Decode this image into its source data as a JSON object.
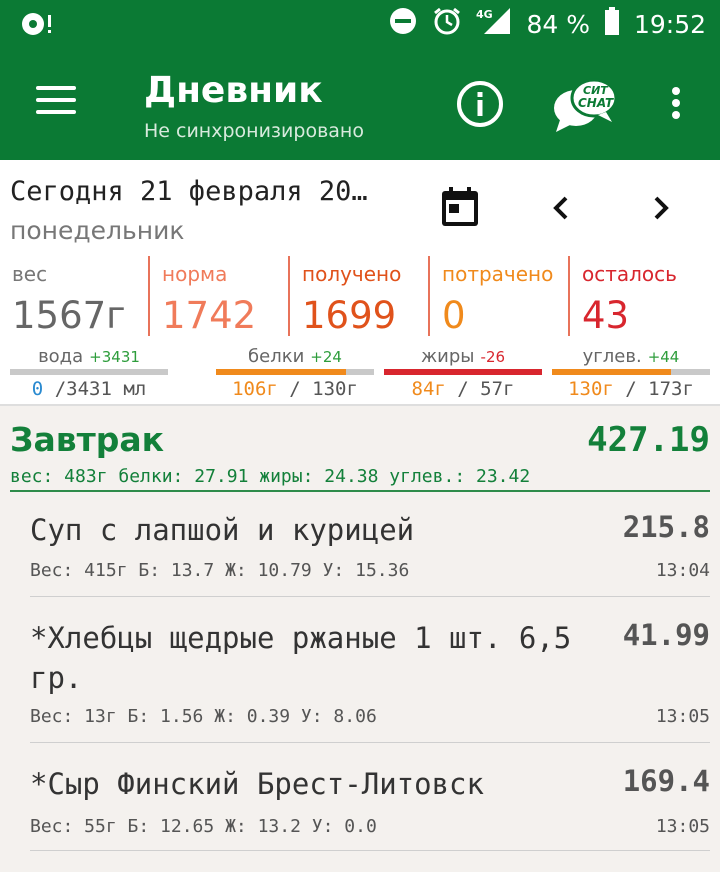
{
  "status_bar": {
    "battery": "84 %",
    "time": "19:52",
    "network": "4G"
  },
  "app_bar": {
    "title": "Дневник",
    "subtitle": "Не синхронизировано",
    "chat_logo_top": "СИТ",
    "chat_logo_bottom": "CHAT"
  },
  "date": {
    "label": "Сегодня 21 февраля 20…",
    "weekday": "понедельник",
    "prev_icon": "‹",
    "next_icon": "›"
  },
  "stats": [
    {
      "label": "вес",
      "value": "1567г",
      "label_color": "#777777",
      "value_color": "#666666"
    },
    {
      "label": "норма",
      "value": "1742",
      "label_color": "#f07b5a",
      "value_color": "#f07b5a"
    },
    {
      "label": "получено",
      "value": "1699",
      "label_color": "#e0521b",
      "value_color": "#e0521b"
    },
    {
      "label": "потрачено",
      "value": "0",
      "label_color": "#f08a1c",
      "value_color": "#f08a1c"
    },
    {
      "label": "осталось",
      "value": "43",
      "label_color": "#d8262e",
      "value_color": "#d8262e"
    }
  ],
  "macros": [
    {
      "label": "вода",
      "delta": "+3431",
      "delta_color": "#2e9d3c",
      "current": "0",
      "rest": " /3431 мл",
      "current_color": "#2a8ad0",
      "fill_color": "#2a8ad0",
      "progress": 0.0
    },
    {
      "label": "белки",
      "delta": "+24",
      "delta_color": "#2e9d3c",
      "current": "106г",
      "rest": " / 130г",
      "current_color": "#f08a1c",
      "fill_color": "#f08a1c",
      "progress": 0.82
    },
    {
      "label": "жиры",
      "delta": "-26",
      "delta_color": "#d8262e",
      "current": "84г",
      "rest": " / 57г",
      "current_color": "#f08a1c",
      "fill_color": "#d8262e",
      "progress": 1.0
    },
    {
      "label": "углев.",
      "delta": "+44",
      "delta_color": "#2e9d3c",
      "current": "130г",
      "rest": " / 173г",
      "current_color": "#f08a1c",
      "fill_color": "#f08a1c",
      "progress": 0.75
    }
  ],
  "meal": {
    "title": "Завтрак",
    "total": "427.19",
    "summary": "вес: 483г  белки: 27.91  жиры: 24.38  углев.: 23.42",
    "items": [
      {
        "name": "Суп с лапшой и курицей",
        "calories": "215.8",
        "details": "Вес: 415г Б: 13.7 Ж: 10.79 У: 15.36",
        "time": "13:04"
      },
      {
        "name": "*Хлебцы щедрые ржаные 1 шт. 6,5 гр.",
        "calories": "41.99",
        "details": "Вес: 13г Б: 1.56 Ж: 0.39 У: 8.06",
        "time": "13:05"
      },
      {
        "name": "*Сыр Финский Брест-Литовск",
        "calories": "169.4",
        "details": "Вес: 55г Б: 12.65 Ж: 13.2 У: 0.0",
        "time": "13:05"
      }
    ]
  },
  "colors": {
    "primary": "#0b7a34",
    "accent_green": "#13803a"
  }
}
